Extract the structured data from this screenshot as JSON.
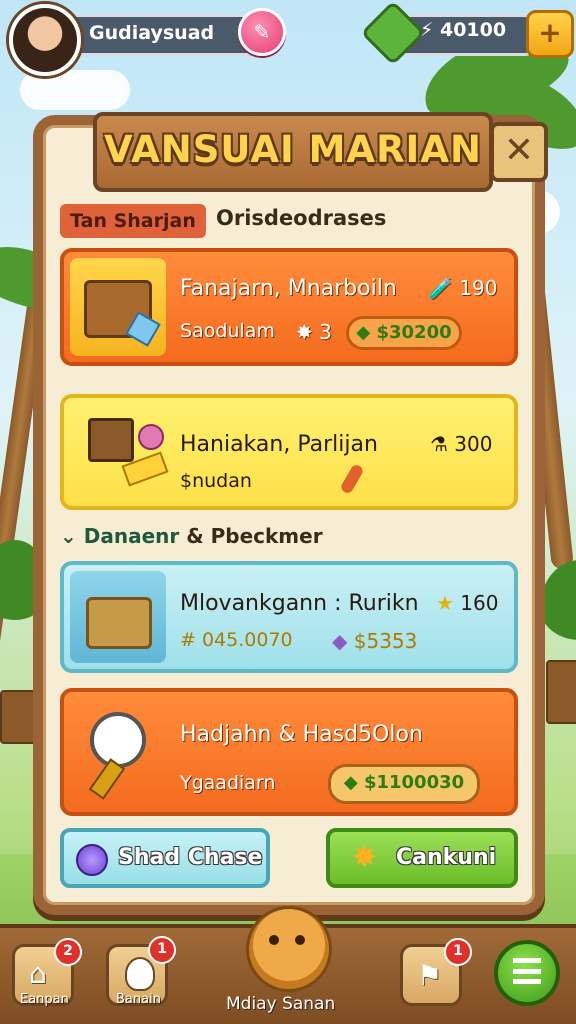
{
  "player": {
    "name": "Gudiaysuad",
    "currency": "40100"
  },
  "panel": {
    "title": "VANSUAI MARIAN",
    "close": "✕",
    "tab": "Tan Sharjan",
    "subheading": "Orisdeodrases"
  },
  "cards": [
    {
      "title": "Fanajarn, Mnarboiln",
      "count": "190",
      "subtitle": "Saodulam",
      "mid": "3",
      "price": "$30200"
    },
    {
      "title": "Haniakan, Parlijan",
      "count": "300",
      "subtitle": "$nudan"
    },
    {
      "title": "Mlovankgann : Rurikn",
      "count": "160",
      "subtitle": "# 045.0070",
      "price": "$5353"
    },
    {
      "title": "Hadjahn & Hasd5Olon",
      "subtitle": "Ygaadiarn",
      "price": "$1100030"
    }
  ],
  "section": {
    "title": "Danaenr",
    "amp_text": "& Pbeckmer"
  },
  "buttons": {
    "left": "Shad Chase",
    "right": "Cankuni"
  },
  "nav": {
    "home_label": "Eanpan",
    "home_badge": "2",
    "second_label": "Banain",
    "second_badge": "1",
    "mascot_label": "Mdiay Sanan",
    "flag_badge": "1"
  }
}
